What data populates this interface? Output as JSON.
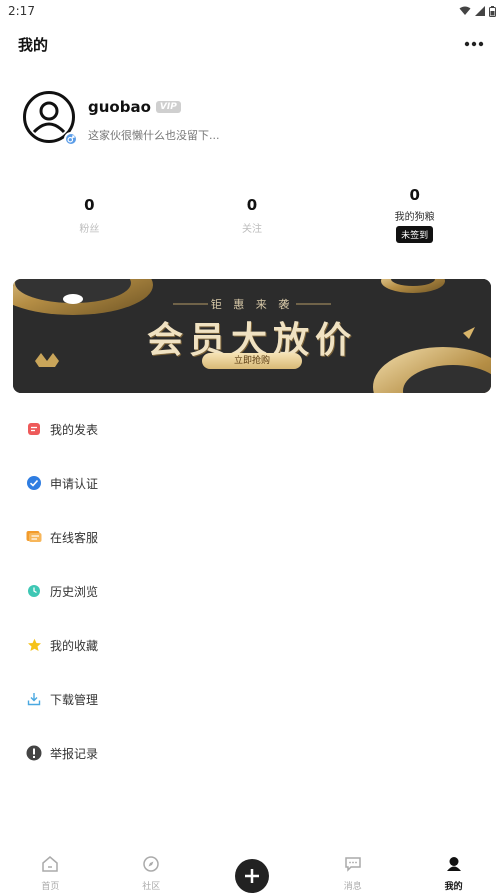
{
  "status_bar": {
    "time": "2:17",
    "icons": [
      "wifi-icon",
      "signal-icon",
      "battery-icon"
    ]
  },
  "header": {
    "title": "我的",
    "more_icon": "more-dots-icon"
  },
  "profile": {
    "username": "guobao",
    "vip_label": "VIP",
    "bio": "这家伙很懒什么也没留下...",
    "avatar_icon": "user-avatar-icon",
    "badge_icon": "gender-male-icon"
  },
  "stats": [
    {
      "value": "0",
      "label": "粉丝"
    },
    {
      "value": "0",
      "label": "关注"
    },
    {
      "value": "0",
      "label": "我的狗粮",
      "tag": "未签到"
    }
  ],
  "banner": {
    "subtitle": "钜 惠 来 袭",
    "title": "会员大放价",
    "button": "立即抢购"
  },
  "menu": [
    {
      "label": "我的发表",
      "icon": "post-icon",
      "color": "#ee5a5a"
    },
    {
      "label": "申请认证",
      "icon": "verified-icon",
      "color": "#2f7de1"
    },
    {
      "label": "在线客服",
      "icon": "chat-service-icon",
      "color": "#f29b2c"
    },
    {
      "label": "历史浏览",
      "icon": "history-clock-icon",
      "color": "#3ec7b4"
    },
    {
      "label": "我的收藏",
      "icon": "star-icon",
      "color": "#f5c21a"
    },
    {
      "label": "下载管理",
      "icon": "download-icon",
      "color": "#4aa8e0"
    },
    {
      "label": "举报记录",
      "icon": "report-icon",
      "color": "#444444"
    }
  ],
  "bottom_nav": [
    {
      "label": "首页",
      "icon": "home-icon"
    },
    {
      "label": "社区",
      "icon": "compass-icon"
    },
    {
      "label": "",
      "icon": "plus-icon"
    },
    {
      "label": "消息",
      "icon": "message-icon"
    },
    {
      "label": "我的",
      "icon": "profile-icon",
      "active": true
    }
  ]
}
